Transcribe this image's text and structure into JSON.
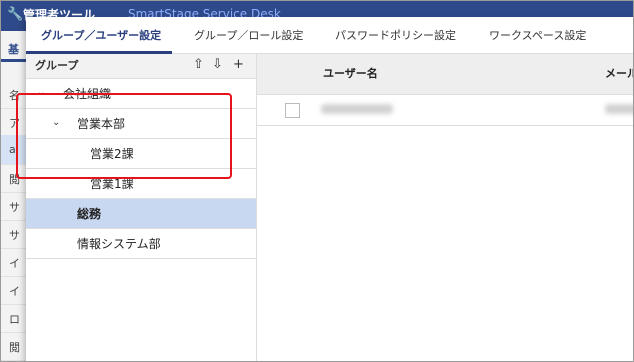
{
  "background": {
    "title": "管理者ツール",
    "subtitle": "SmartStage Service Desk",
    "tab": "基",
    "cells": [
      "名",
      "ア",
      "a",
      "閲",
      "サ",
      "サ",
      "イ",
      "イ",
      "ロ",
      "閲"
    ]
  },
  "tabs": [
    {
      "label": "グループ／ユーザー設定",
      "active": true
    },
    {
      "label": "グループ／ロール設定",
      "active": false
    },
    {
      "label": "パスワードポリシー設定",
      "active": false
    },
    {
      "label": "ワークスペース設定",
      "active": false
    }
  ],
  "group_panel": {
    "header": "グループ",
    "icons": [
      "upload-icon",
      "download-icon",
      "add-icon"
    ],
    "icon_glyphs": [
      "⇧",
      "⇩",
      "+"
    ],
    "tree": [
      {
        "label": "会社組織",
        "expanded": true
      },
      {
        "label": "営業本部",
        "expanded": true
      },
      {
        "label": "営業2課"
      },
      {
        "label": "営業1課"
      },
      {
        "label": "総務",
        "selected": true
      },
      {
        "label": "情報システム部"
      }
    ]
  },
  "user_table": {
    "columns": [
      "ユーザー名",
      "メール"
    ]
  },
  "colors": {
    "accent": "#2a3f7e",
    "selection": "#c9d8f1",
    "highlight_box": "#e5141c"
  }
}
